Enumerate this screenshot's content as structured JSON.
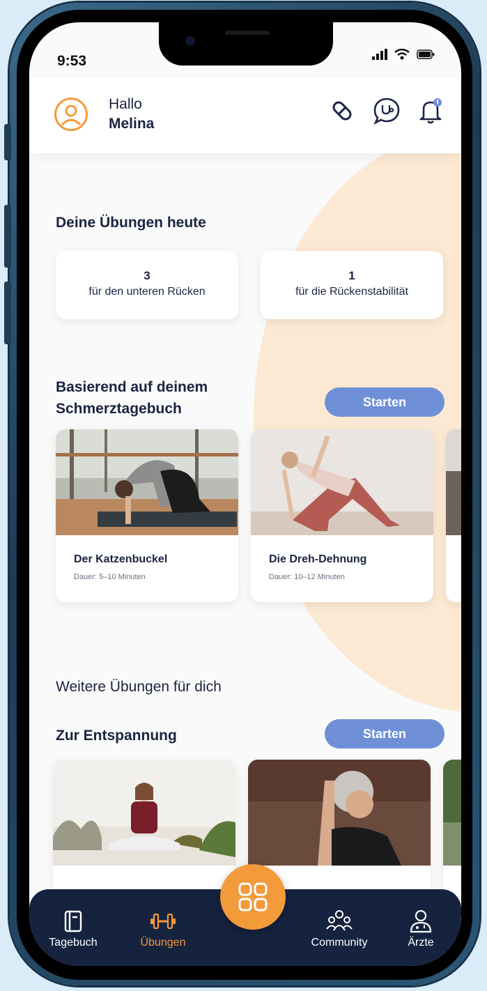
{
  "status": {
    "time": "9:53"
  },
  "header": {
    "greeting": "Hallo",
    "name": "Melina"
  },
  "today": {
    "title": "Deine Übungen heute",
    "cards": [
      {
        "count": "3",
        "label": "für den unteren Rücken"
      },
      {
        "count": "1",
        "label": "für die Rückenstabilität"
      }
    ]
  },
  "diary_section": {
    "title_line1": "Basierend auf deinem",
    "title_line2": "Schmerztagebuch",
    "start_label": "Starten",
    "exercises": [
      {
        "title": "Der Katzenbuckel",
        "duration": "Dauer: 5–10 Minuten"
      },
      {
        "title": "Die Dreh-Dehnung",
        "duration": "Dauer: 10–12 Minuten"
      }
    ]
  },
  "more": {
    "title": "Weitere Übungen für dich"
  },
  "relax_section": {
    "title": "Zur Entspannung",
    "start_label": "Starten"
  },
  "nav": {
    "items": [
      {
        "label": "Tagebuch",
        "icon": "diary-icon",
        "active": false
      },
      {
        "label": "Übungen",
        "icon": "dumbbell-icon",
        "active": true
      },
      {
        "label": "Community",
        "icon": "community-icon",
        "active": false
      },
      {
        "label": "Ärzte",
        "icon": "doctor-icon",
        "active": false
      }
    ],
    "center_icon": "grid-icon"
  },
  "colors": {
    "accent_orange": "#f39a3b",
    "button_blue": "#6f8fd6",
    "navy": "#16233f",
    "peach_bg": "#fbe9d3"
  }
}
